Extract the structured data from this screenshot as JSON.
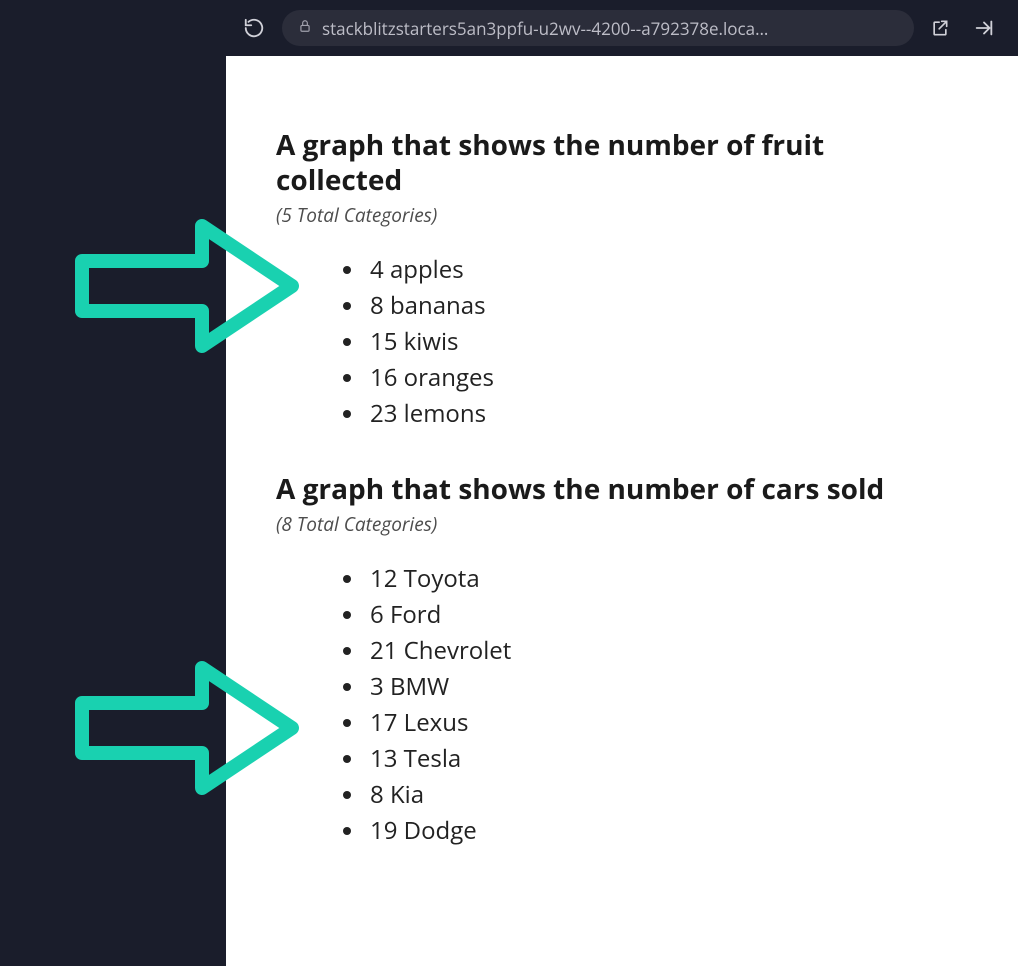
{
  "browser": {
    "url": "stackblitzstarters5an3ppfu-u2wv--4200--a792378e.loca…"
  },
  "sections": [
    {
      "title": "A graph that shows the number of fruit collected",
      "subtitle": "(5 Total Categories)",
      "items": [
        {
          "value": 4,
          "label": "apples"
        },
        {
          "value": 8,
          "label": "bananas"
        },
        {
          "value": 15,
          "label": "kiwis"
        },
        {
          "value": 16,
          "label": "oranges"
        },
        {
          "value": 23,
          "label": "lemons"
        }
      ]
    },
    {
      "title": "A graph that shows the number of cars sold",
      "subtitle": "(8 Total Categories)",
      "items": [
        {
          "value": 12,
          "label": "Toyota"
        },
        {
          "value": 6,
          "label": "Ford"
        },
        {
          "value": 21,
          "label": "Chevrolet"
        },
        {
          "value": 3,
          "label": "BMW"
        },
        {
          "value": 17,
          "label": "Lexus"
        },
        {
          "value": 13,
          "label": "Tesla"
        },
        {
          "value": 8,
          "label": "Kia"
        },
        {
          "value": 19,
          "label": "Dodge"
        }
      ]
    }
  ],
  "annotation_color": "#19d1b0"
}
